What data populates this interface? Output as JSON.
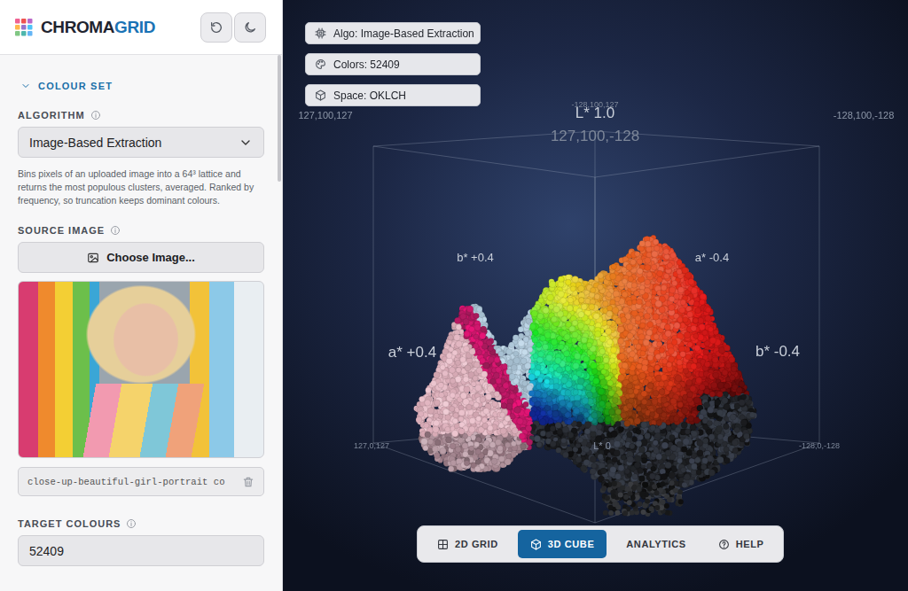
{
  "app": {
    "logo_main": "CHROMA",
    "logo_accent": "GRID"
  },
  "sidebar": {
    "section": {
      "title": "COLOUR SET",
      "expanded": true
    },
    "algorithm": {
      "label": "ALGORITHM",
      "value": "Image-Based Extraction",
      "description": "Bins pixels of an uploaded image into a 64³ lattice and returns the most populous clusters, averaged. Ranked by frequency, so truncation keeps dominant colours."
    },
    "source_image": {
      "label": "SOURCE IMAGE",
      "button": "Choose Image...",
      "file_name": "close-up-beautiful-girl-portrait co"
    },
    "target_colours": {
      "label": "TARGET COLOURS",
      "value": "52409"
    }
  },
  "viewport": {
    "badges": [
      {
        "text": "Algo: Image-Based Extraction",
        "kind": "chip"
      },
      {
        "text": "Colors: 52409",
        "kind": "palette"
      },
      {
        "text": "Space: OKLCH",
        "kind": "cube"
      }
    ],
    "axis_labels": [
      "127,100,127",
      "-128,100,127",
      "L* 1.0",
      "127,100,-128",
      "-128,100,-128",
      "b* +0.4",
      "a* -0.4",
      "a* +0.4",
      "b* -0.4",
      "127,0,127",
      "L* 0",
      "-128,0,-128"
    ],
    "view_tabs": [
      {
        "label": "2D GRID",
        "kind": "grid",
        "selected": false
      },
      {
        "label": "3D CUBE",
        "kind": "cube",
        "selected": true
      },
      {
        "label": "ANALYTICS",
        "kind": "none",
        "selected": false
      },
      {
        "label": "HELP",
        "kind": "help",
        "selected": false
      }
    ]
  }
}
